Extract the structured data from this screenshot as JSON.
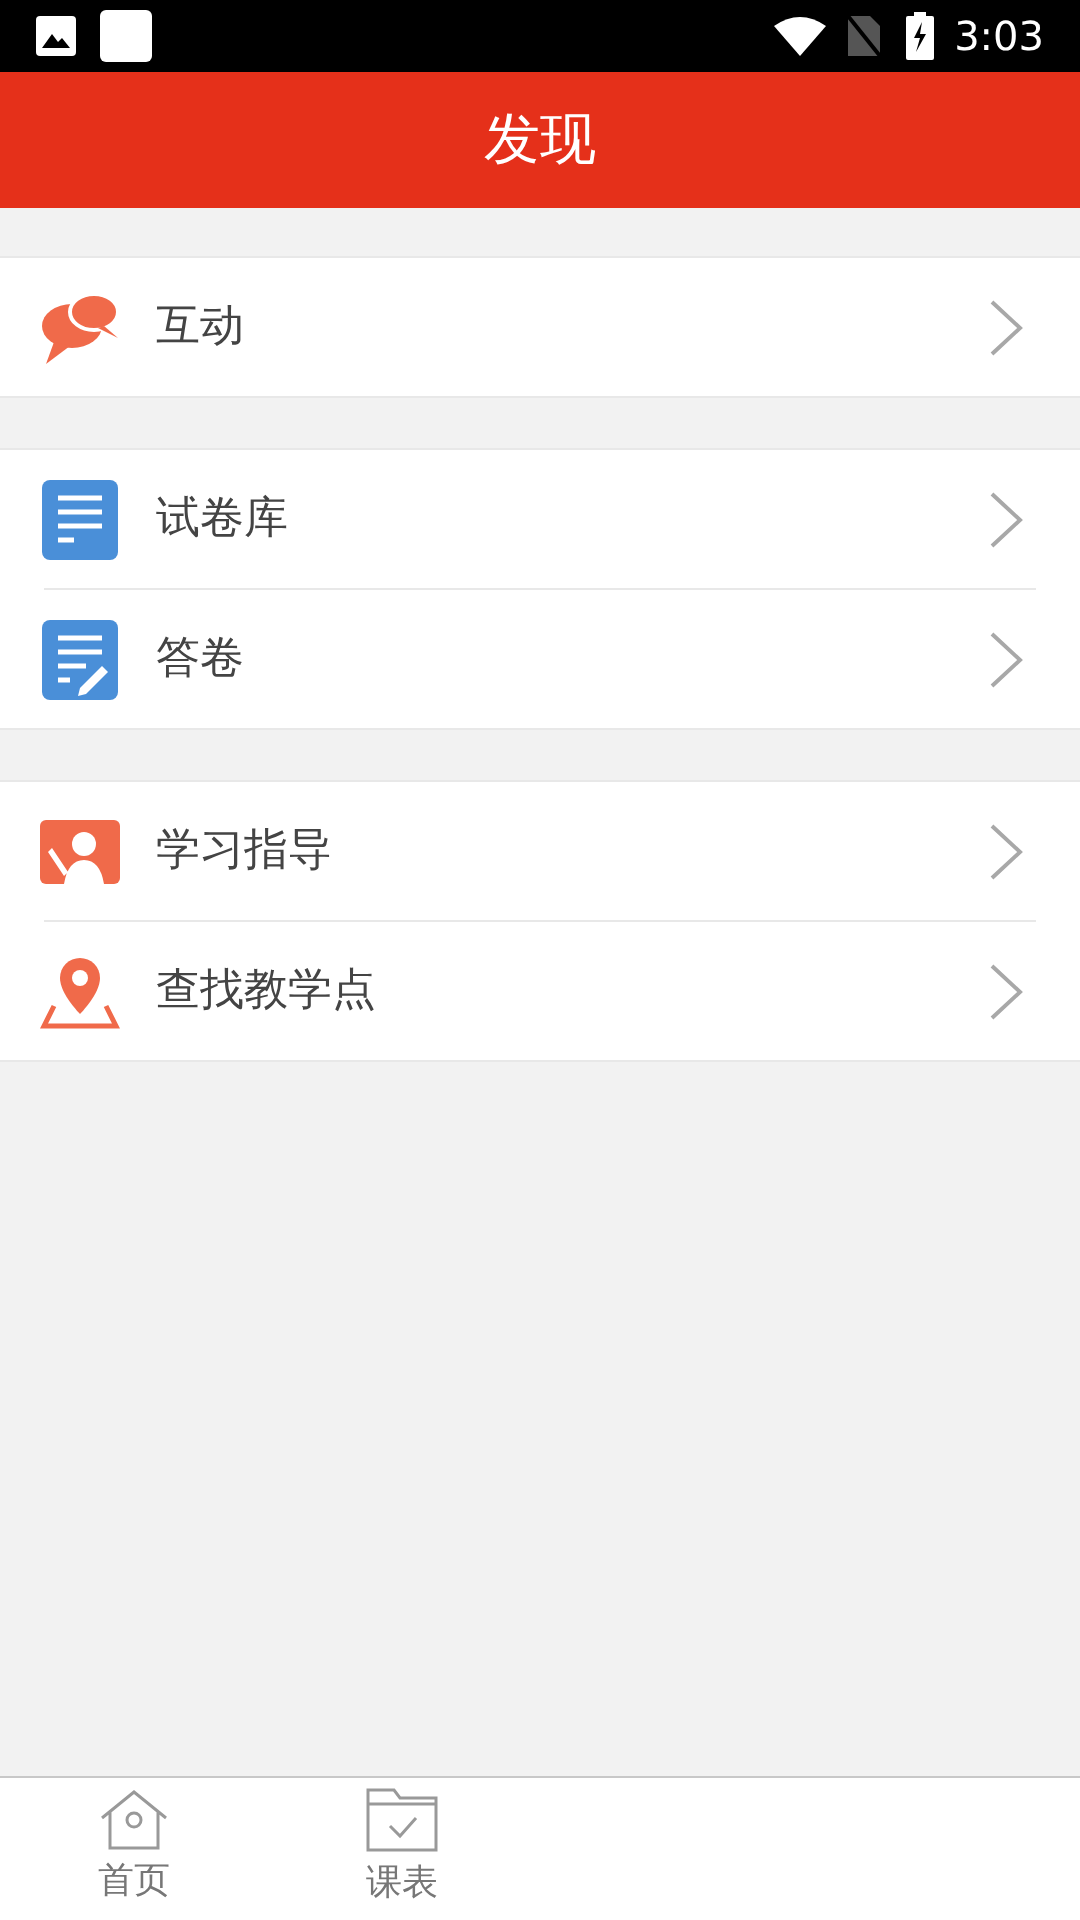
{
  "status_bar": {
    "time": "3:03"
  },
  "header": {
    "title": "发现"
  },
  "groups": [
    {
      "items": [
        {
          "label": "互动"
        }
      ]
    },
    {
      "items": [
        {
          "label": "试卷库"
        },
        {
          "label": "答卷"
        }
      ]
    },
    {
      "items": [
        {
          "label": "学习指导"
        },
        {
          "label": "查找教学点"
        }
      ]
    }
  ],
  "tab_bar": {
    "tabs": [
      {
        "label": "首页"
      },
      {
        "label": "课表"
      }
    ]
  }
}
